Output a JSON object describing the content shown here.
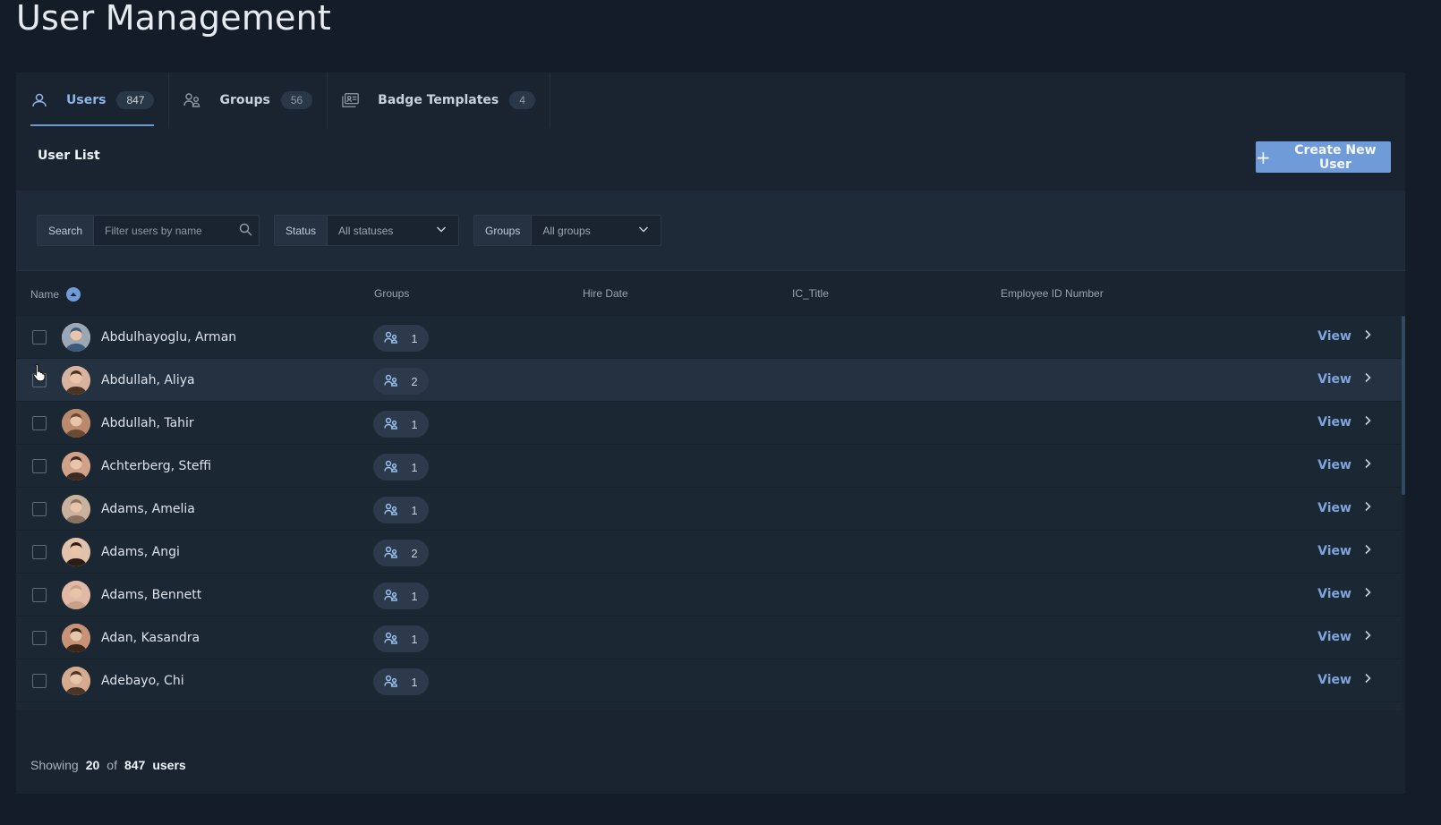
{
  "page": {
    "title": "User Management"
  },
  "tabs": [
    {
      "label": "Users",
      "count": "847",
      "icon": "user-icon",
      "active": true
    },
    {
      "label": "Groups",
      "count": "56",
      "icon": "groups-icon",
      "active": false
    },
    {
      "label": "Badge Templates",
      "count": "4",
      "icon": "badge-icon",
      "active": false
    }
  ],
  "toolbar": {
    "list_title": "User List",
    "create_button": "Create New User"
  },
  "filters": {
    "search_label": "Search",
    "search_placeholder": "Filter users by name",
    "status_label": "Status",
    "status_value": "All statuses",
    "groups_label": "Groups",
    "groups_value": "All groups"
  },
  "table": {
    "columns": [
      "Name",
      "Groups",
      "Hire Date",
      "IC_Title",
      "Employee ID Number"
    ],
    "view_label": "View",
    "rows": [
      {
        "name": "Abdulhayoglu, Arman",
        "groups": "1"
      },
      {
        "name": "Abdullah, Aliya",
        "groups": "2"
      },
      {
        "name": "Abdullah, Tahir",
        "groups": "1"
      },
      {
        "name": "Achterberg, Steffi",
        "groups": "1"
      },
      {
        "name": "Adams, Amelia",
        "groups": "1"
      },
      {
        "name": "Adams, Angi",
        "groups": "2"
      },
      {
        "name": "Adams, Bennett",
        "groups": "1"
      },
      {
        "name": "Adan, Kasandra",
        "groups": "1"
      },
      {
        "name": "Adebayo, Chi",
        "groups": "1"
      }
    ]
  },
  "footer": {
    "prefix": "Showing",
    "shown": "20",
    "of": "of",
    "total": "847",
    "suffix": "users"
  },
  "colors": {
    "accent": "#6f9bd8",
    "link": "#7ea6dc",
    "background": "#131c27",
    "panel": "#1a2431"
  }
}
